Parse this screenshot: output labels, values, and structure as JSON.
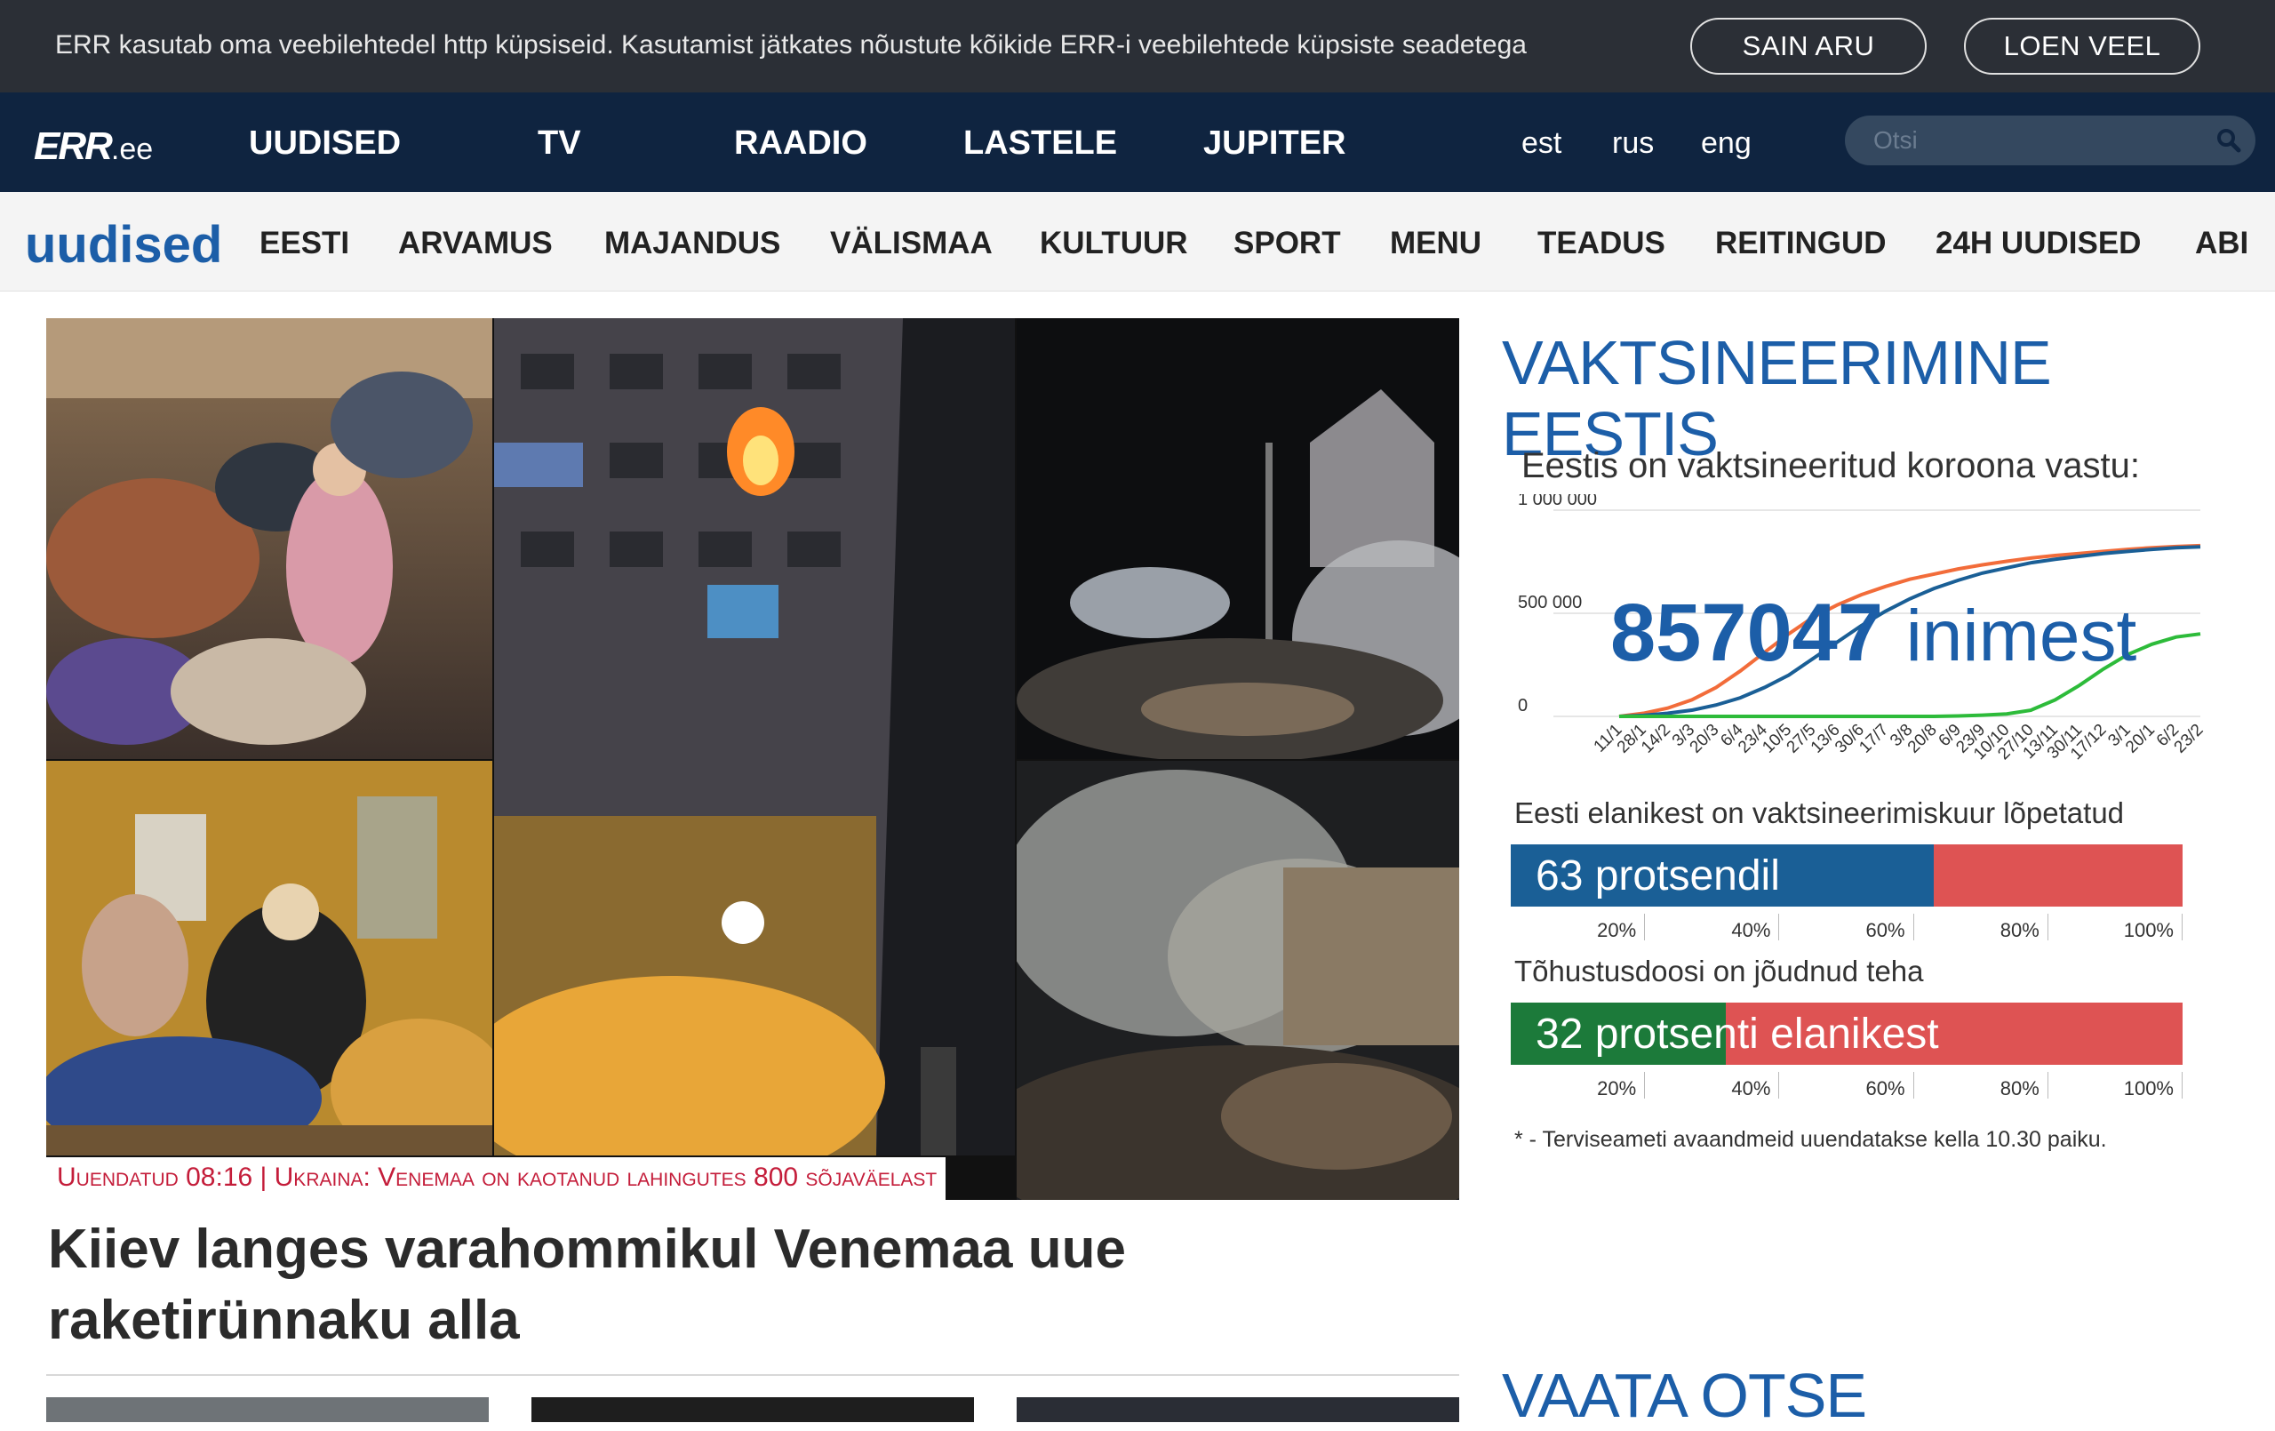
{
  "cookie": {
    "text": "ERR kasutab oma veebilehtedel http küpsiseid. Kasutamist jätkates nõustute kõikide ERR-i veebilehtede küpsiste seadetega",
    "agree_label": "SAIN ARU",
    "more_label": "LOEN VEEL"
  },
  "topnav": {
    "logo": "ERR",
    "logo_suffix": ".ee",
    "items": [
      "UUDISED",
      "TV",
      "RAADIO",
      "LASTELE",
      "JUPITER"
    ],
    "langs": [
      "est",
      "rus",
      "eng"
    ],
    "search_placeholder": "Otsi"
  },
  "subnav": {
    "brand": "uudised",
    "items": [
      "EESTI",
      "ARVAMUS",
      "MAJANDUS",
      "VÄLISMAA",
      "KULTUUR",
      "SPORT",
      "MENU",
      "TEADUS",
      "REITINGUD",
      "24H UUDISED",
      "ABI"
    ]
  },
  "article": {
    "caption": "Uuendatud 08:16 | Ukraina: Venemaa on kaotanud lahingutes 800 sõjaväelast",
    "headline": "Kiiev langes varahommikul Venemaa uue raketirünnaku alla"
  },
  "vax": {
    "title": "VAKTSINEERIMINE EESTIS",
    "subtitle": "Eestis on vaktsineeritud koroona vastu:",
    "number": "857047",
    "number_unit": "inimest",
    "bar1_label": "Eesti elanikest on vaktsineerimiskuur lõpetatud",
    "bar1_text": "63  protsendil",
    "bar2_label": "Tõhustusdoosi on jõudnud teha",
    "bar2_text": "32  protsenti elanikest",
    "note": "* - Terviseameti avaandmeid uuendatakse kella 10.30 paiku.",
    "colors": {
      "blue": "#1a5f96",
      "green": "#1c7a3a",
      "red": "#de5353",
      "orange": "#f26c3a",
      "line_green": "#2dbb3a"
    }
  },
  "vaata": "VAATA OTSE",
  "chart_data": [
    {
      "type": "line",
      "x": [
        "11/1",
        "28/1",
        "14/2",
        "3/3",
        "20/3",
        "6/4",
        "23/4",
        "10/5",
        "27/5",
        "13/6",
        "30/6",
        "17/7",
        "3/8",
        "20/8",
        "6/9",
        "23/9",
        "10/10",
        "27/10",
        "13/11",
        "30/11",
        "17/12",
        "3/1",
        "20/1",
        "6/2",
        "23/2"
      ],
      "ylabels": [
        "1 000 000",
        "500 000",
        "0"
      ],
      "ylim": [
        0,
        1000000
      ],
      "series": [
        {
          "color": "#f26c3a",
          "values": [
            0,
            15000,
            40000,
            80000,
            140000,
            220000,
            310000,
            400000,
            480000,
            540000,
            590000,
            630000,
            665000,
            690000,
            715000,
            735000,
            752000,
            768000,
            780000,
            790000,
            800000,
            810000,
            818000,
            824000,
            828000
          ]
        },
        {
          "color": "#1a5f96",
          "values": [
            0,
            5000,
            15000,
            30000,
            55000,
            90000,
            140000,
            200000,
            280000,
            360000,
            440000,
            510000,
            570000,
            620000,
            660000,
            695000,
            720000,
            745000,
            762000,
            776000,
            790000,
            800000,
            810000,
            818000,
            822000
          ]
        },
        {
          "color": "#2dbb3a",
          "values": [
            0,
            0,
            0,
            0,
            0,
            0,
            0,
            0,
            0,
            0,
            0,
            0,
            0,
            0,
            2000,
            6000,
            12000,
            30000,
            80000,
            150000,
            230000,
            300000,
            350000,
            385000,
            400000
          ]
        }
      ]
    },
    {
      "type": "bar",
      "categories": [
        "lõpetatud"
      ],
      "values": [
        63
      ],
      "ylim": [
        0,
        100
      ],
      "ticks": [
        "20%",
        "40%",
        "60%",
        "80%",
        "100%"
      ]
    },
    {
      "type": "bar",
      "categories": [
        "tõhustusdoos"
      ],
      "values": [
        32
      ],
      "ylim": [
        0,
        100
      ],
      "ticks": [
        "20%",
        "40%",
        "60%",
        "80%",
        "100%"
      ]
    }
  ]
}
